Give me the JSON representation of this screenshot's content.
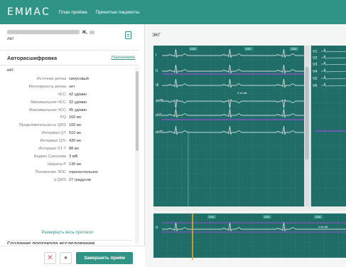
{
  "app": {
    "logo": "ЕМИАС",
    "nav": [
      "План приёма",
      "Принятые пациенты"
    ]
  },
  "patient": {
    "sex": "Ж,",
    "note": "лет"
  },
  "auto_decode": {
    "title": "Авторасшифровка",
    "assign_link": "Назначение",
    "value": "нет",
    "params": [
      {
        "label": "Источник ритма",
        "value": "синусовый"
      },
      {
        "label": "Регулярность ритма",
        "value": "нет"
      },
      {
        "label": "ЧСС",
        "value": "42 уд/мин"
      },
      {
        "label": "Минимальная ЧСС",
        "value": "32 уд/мин"
      },
      {
        "label": "Максимальная ЧСС",
        "value": "45 уд/мин"
      },
      {
        "label": "PQ",
        "value": "160 мс"
      },
      {
        "label": "Продолжительность QRS",
        "value": "100 мс"
      },
      {
        "label": "Интервал QT",
        "value": "510 мс"
      },
      {
        "label": "Интервал QTc",
        "value": "430 мс"
      },
      {
        "label": "Интервал ST-T",
        "value": "88 мс"
      },
      {
        "label": "Индекс Соколова",
        "value": "3 мВ"
      },
      {
        "label": "Ширина P",
        "value": "130 мс"
      },
      {
        "label": "Положение ЭОС",
        "value": "горизонтальное"
      },
      {
        "label": "α QRS",
        "value": "27 градусов"
      }
    ],
    "expand_link": "Развернуть весь протокол",
    "next_section": "Создание протокола исследования"
  },
  "buttons": {
    "cancel": "✕",
    "stop": "■",
    "finish": "Завершить приём"
  },
  "ekg": {
    "label": "ЭКГ",
    "leads_left": [
      "I",
      "II",
      "III",
      "aVR",
      "aVL",
      "aVF"
    ],
    "leads_right": [
      "V1",
      "V2",
      "V3",
      "V4",
      "V5",
      "V6"
    ],
    "strip_lead": "II",
    "marker_labels": [
      "1226",
      "1000",
      "1248"
    ],
    "amplitude_label": "0.15 мВ",
    "strip_amplitude": "0.94 мВ",
    "grid_color": "#1f6b66",
    "trace_color": "#ffffff",
    "accent_color": "#9a4fd6",
    "cursor_color": "#f5a623"
  }
}
